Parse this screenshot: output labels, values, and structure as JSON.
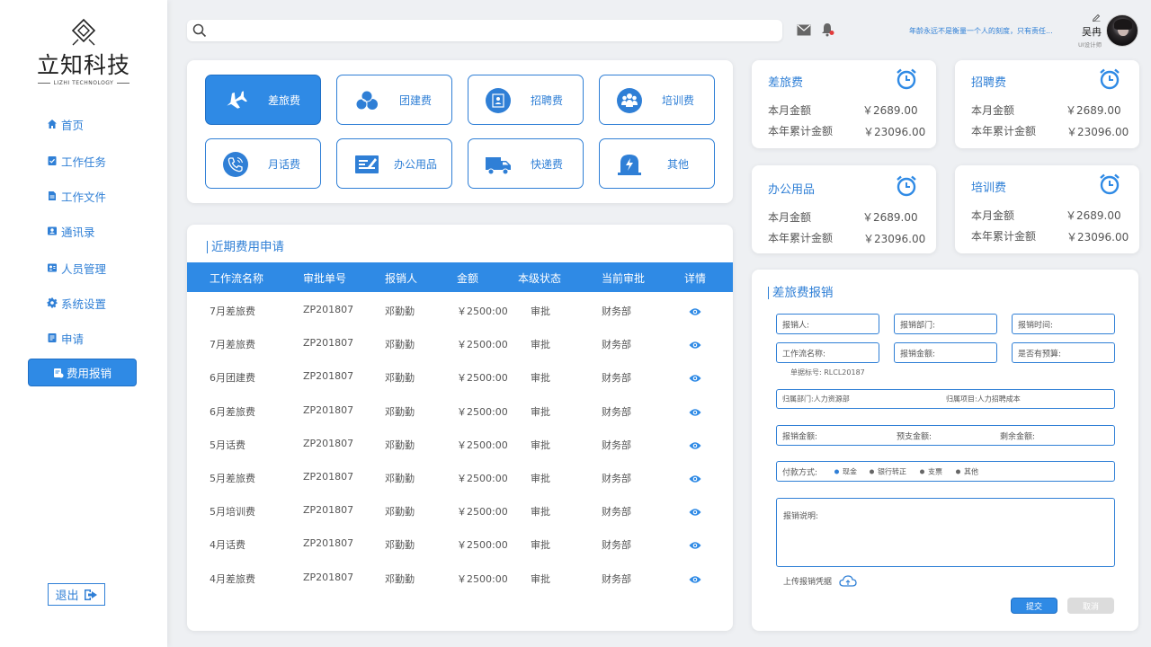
{
  "brand": {
    "name": "立知科技",
    "sub": "LIZHI TECHNOLOGY"
  },
  "sidebar": {
    "items": [
      {
        "label": "首页"
      },
      {
        "label": "工作任务"
      },
      {
        "label": "工作文件"
      },
      {
        "label": "通讯录"
      },
      {
        "label": "人员管理"
      },
      {
        "label": "系统设置"
      },
      {
        "label": "申请"
      },
      {
        "label": "费用报销"
      }
    ],
    "logout": "退出"
  },
  "header": {
    "search_value": "",
    "motto": "年龄永远不是衡量一个人的刻度，只有责任...",
    "user_name": "吴冉",
    "user_role": "UI设计师"
  },
  "categories": [
    {
      "label": "差旅费",
      "icon": "plane-icon"
    },
    {
      "label": "团建费",
      "icon": "team-icon"
    },
    {
      "label": "招聘费",
      "icon": "recruit-icon"
    },
    {
      "label": "培训费",
      "icon": "training-icon"
    },
    {
      "label": "月话费",
      "icon": "phone-icon"
    },
    {
      "label": "办公用品",
      "icon": "office-supplies-icon"
    },
    {
      "label": "快递费",
      "icon": "delivery-truck-icon"
    },
    {
      "label": "其他",
      "icon": "other-icon"
    }
  ],
  "recent": {
    "title": "近期费用申请",
    "columns": [
      "工作流名称",
      "审批单号",
      "报销人",
      "金额",
      "本级状态",
      "当前审批",
      "详情"
    ],
    "rows": [
      [
        "7月差旅费",
        "ZP201807",
        "邓勤勤",
        "￥2500:00",
        "审批",
        "财务部"
      ],
      [
        "7月差旅费",
        "ZP201807",
        "邓勤勤",
        "￥2500:00",
        "审批",
        "财务部"
      ],
      [
        "6月团建费",
        "ZP201807",
        "邓勤勤",
        "￥2500:00",
        "审批",
        "财务部"
      ],
      [
        "6月差旅费",
        "ZP201807",
        "邓勤勤",
        "￥2500:00",
        "审批",
        "财务部"
      ],
      [
        "5月话费",
        "ZP201807",
        "邓勤勤",
        "￥2500:00",
        "审批",
        "财务部"
      ],
      [
        "5月差旅费",
        "ZP201807",
        "邓勤勤",
        "￥2500:00",
        "审批",
        "财务部"
      ],
      [
        "5月培训费",
        "ZP201807",
        "邓勤勤",
        "￥2500:00",
        "审批",
        "财务部"
      ],
      [
        "4月话费",
        "ZP201807",
        "邓勤勤",
        "￥2500:00",
        "审批",
        "财务部"
      ],
      [
        "4月差旅费",
        "ZP201807",
        "邓勤勤",
        "￥2500:00",
        "审批",
        "财务部"
      ]
    ]
  },
  "stats": [
    {
      "title": "差旅费",
      "label1": "本月金额",
      "value1": "￥2689.00",
      "label2": "本年累计金额",
      "value2": "￥23096.00"
    },
    {
      "title": "招聘费",
      "label1": "本月金额",
      "value1": "￥2689.00",
      "label2": "本年累计金额",
      "value2": "￥23096.00"
    },
    {
      "title": "办公用品",
      "label1": "本月金额",
      "value1": "￥2689.00",
      "label2": "本年累计金额",
      "value2": "￥23096.00"
    },
    {
      "title": "培训费",
      "label1": "本月金额",
      "value1": "￥2689.00",
      "label2": "本年累计金额",
      "value2": "￥23096.00"
    }
  ],
  "form": {
    "title": "差旅费报销",
    "applicant": "报销人:",
    "dept": "报销部门:",
    "time": "报销时间:",
    "workflow": "工作流名称:",
    "amount": "报销金额:",
    "budget": "是否有预算:",
    "doc_no": "单据标号: RLCL20187",
    "belong_dept": "归属部门:人力资源部",
    "belong_project": "归属项目:人力招聘成本",
    "reimb_amount": "报销金额:",
    "advance_amount": "预支金额:",
    "remain_amount": "剩余金额:",
    "payment_label": "付款方式:",
    "payment_options": [
      "现金",
      "银行转正",
      "支票",
      "其他"
    ],
    "desc_label": "报销说明:",
    "upload_label": "上传报销凭据",
    "submit": "提交",
    "cancel": "取消"
  },
  "colors": {
    "accent": "#2f8ae5",
    "text_blue": "#2f7fd6",
    "disabled": "#dcdcdc"
  }
}
